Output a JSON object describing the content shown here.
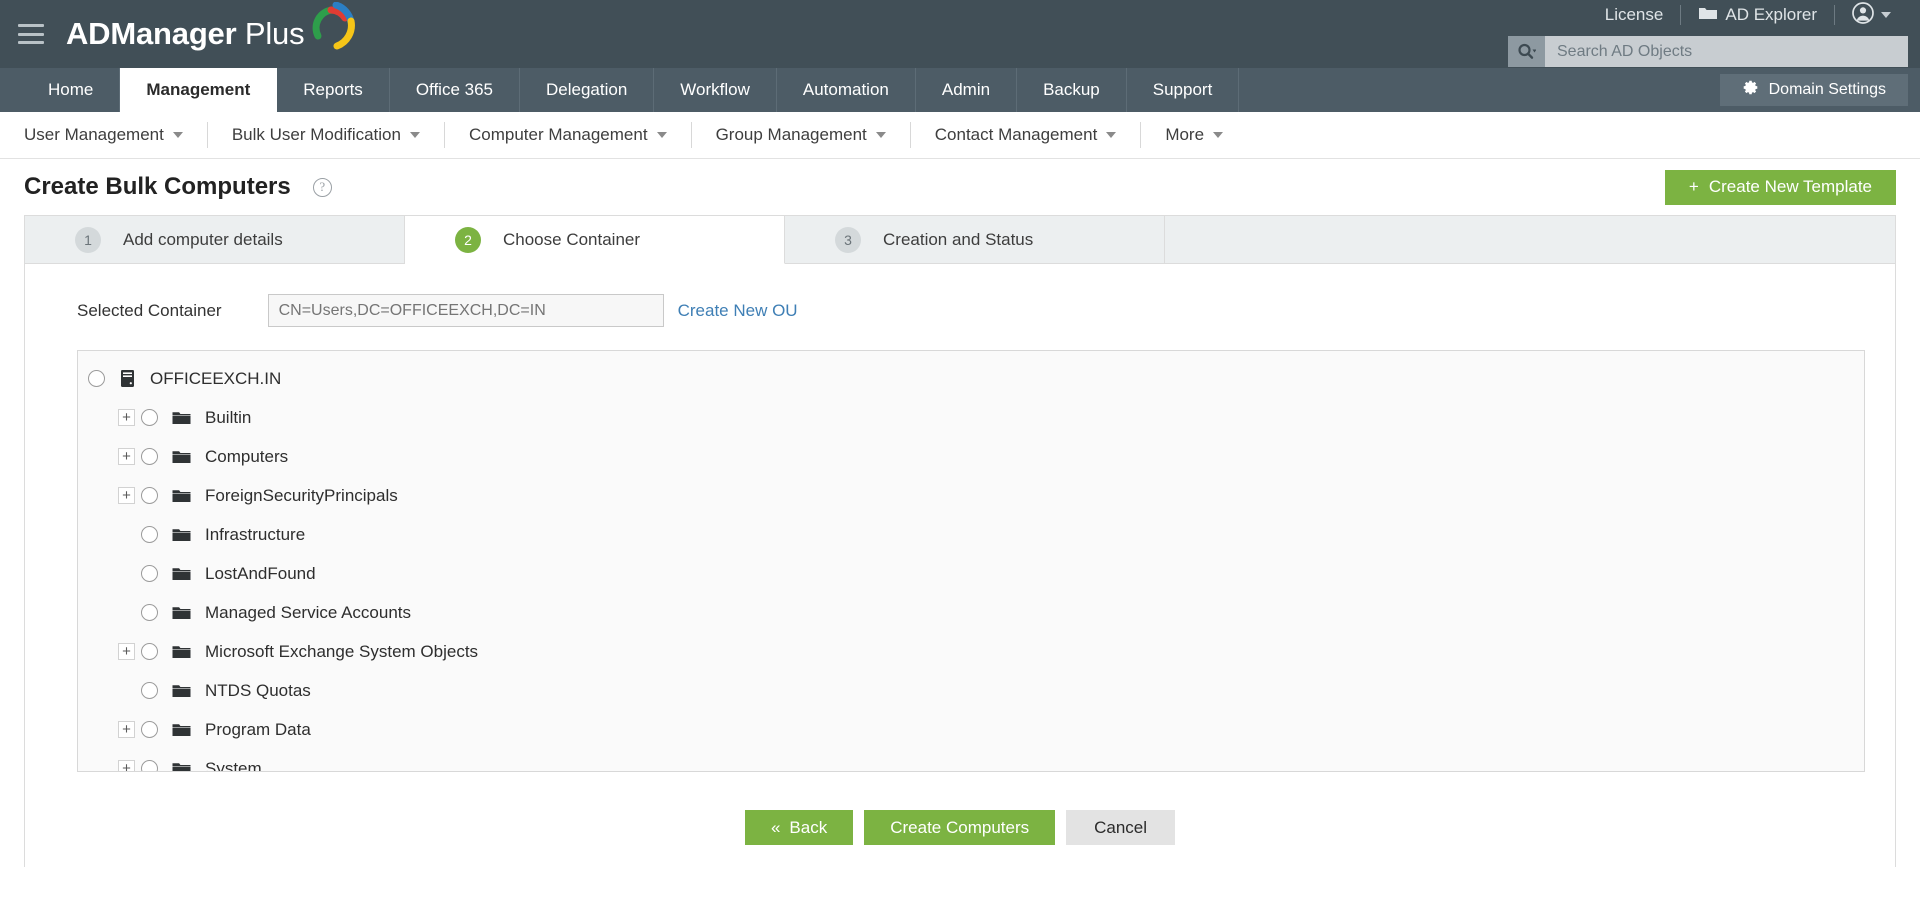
{
  "topbar": {
    "menu_icon": "hamburger-icon",
    "brand_bold": "ADManager",
    "brand_light": " Plus",
    "license_label": "License",
    "ad_explorer_label": "AD Explorer",
    "folder_icon": "folder-icon",
    "account_icon": "user-account-icon",
    "account_caret": "chevron-down-icon",
    "search": {
      "icon": "search-icon",
      "placeholder": "Search AD Objects",
      "value": ""
    }
  },
  "mainnav": {
    "tabs": [
      {
        "label": "Home",
        "active": false
      },
      {
        "label": "Management",
        "active": true
      },
      {
        "label": "Reports",
        "active": false
      },
      {
        "label": "Office 365",
        "active": false
      },
      {
        "label": "Delegation",
        "active": false
      },
      {
        "label": "Workflow",
        "active": false
      },
      {
        "label": "Automation",
        "active": false
      },
      {
        "label": "Admin",
        "active": false
      },
      {
        "label": "Backup",
        "active": false
      },
      {
        "label": "Support",
        "active": false
      }
    ],
    "domain_settings_label": "Domain Settings",
    "domain_settings_icon": "gear-icon"
  },
  "subnav": {
    "items": [
      {
        "label": "User Management"
      },
      {
        "label": "Bulk User Modification"
      },
      {
        "label": "Computer Management"
      },
      {
        "label": "Group Management"
      },
      {
        "label": "Contact Management"
      },
      {
        "label": "More"
      }
    ]
  },
  "page": {
    "title": "Create Bulk Computers",
    "help_glyph": "?",
    "create_template_label": "Create New Template",
    "create_template_plus": "+"
  },
  "wizard": {
    "steps": [
      {
        "num": "1",
        "label": "Add computer details",
        "active": false
      },
      {
        "num": "2",
        "label": "Choose Container",
        "active": true
      },
      {
        "num": "3",
        "label": "Creation and Status",
        "active": false
      }
    ]
  },
  "form": {
    "selected_container_label": "Selected Container",
    "selected_container_value": "CN=Users,DC=OFFICEEXCH,DC=IN",
    "selected_container_placeholder": "CN=Users,DC=OFFICEEXCH,DC=IN",
    "create_new_ou_label": "Create New OU"
  },
  "tree": {
    "root": {
      "label": "OFFICEEXCH.IN",
      "icon": "domain-server-icon",
      "selected": false,
      "expandable": false
    },
    "children": [
      {
        "label": "Builtin",
        "icon": "folder-icon",
        "expandable": true,
        "expander": "+"
      },
      {
        "label": "Computers",
        "icon": "folder-icon",
        "expandable": true,
        "expander": "+"
      },
      {
        "label": "ForeignSecurityPrincipals",
        "icon": "folder-icon",
        "expandable": true,
        "expander": "+"
      },
      {
        "label": "Infrastructure",
        "icon": "folder-icon",
        "expandable": false,
        "expander": ""
      },
      {
        "label": "LostAndFound",
        "icon": "folder-icon",
        "expandable": false,
        "expander": ""
      },
      {
        "label": "Managed Service Accounts",
        "icon": "folder-icon",
        "expandable": false,
        "expander": ""
      },
      {
        "label": "Microsoft Exchange System Objects",
        "icon": "folder-icon",
        "expandable": true,
        "expander": "+"
      },
      {
        "label": "NTDS Quotas",
        "icon": "folder-icon",
        "expandable": false,
        "expander": ""
      },
      {
        "label": "Program Data",
        "icon": "folder-icon",
        "expandable": true,
        "expander": "+"
      },
      {
        "label": "System",
        "icon": "folder-icon",
        "expandable": true,
        "expander": "+"
      }
    ]
  },
  "footer": {
    "back_label": "Back",
    "back_icon": "double-chevron-left-icon",
    "create_label": "Create Computers",
    "cancel_label": "Cancel"
  },
  "colors": {
    "topbar_bg": "#414f57",
    "nav_bg": "#4d5c66",
    "accent_green": "#7cb342",
    "link_blue": "#3f7fb5",
    "step_bg": "#eceff0"
  }
}
